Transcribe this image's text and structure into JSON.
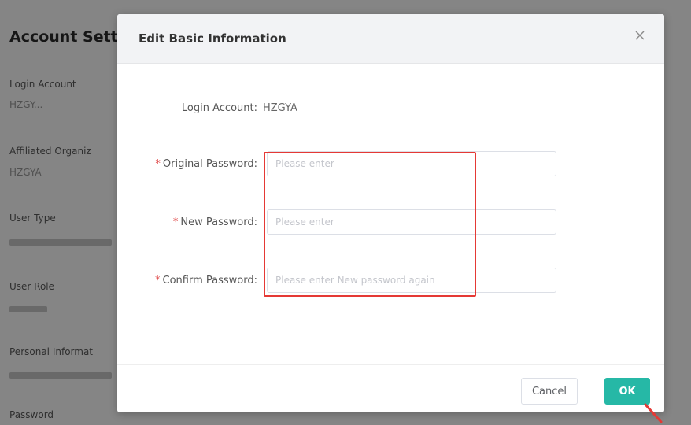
{
  "background": {
    "title": "Account Setti",
    "fields": [
      {
        "label": "Login Account",
        "value": "HZGY..."
      },
      {
        "label": "Affiliated Organiz",
        "value": "HZGYA"
      },
      {
        "label": "User Type",
        "value": ""
      },
      {
        "label": "User Role",
        "value": ""
      },
      {
        "label": "Personal Informat",
        "value": ""
      },
      {
        "label": "Password",
        "value": ""
      }
    ]
  },
  "dialog": {
    "title": "Edit Basic Information",
    "close_icon": "close-icon",
    "login_account": {
      "label": "Login Account:",
      "value": "HZGYA"
    },
    "original_password": {
      "required_mark": "*",
      "label": "Original Password:",
      "placeholder": "Please enter"
    },
    "new_password": {
      "required_mark": "*",
      "label": "New Password:",
      "placeholder": "Please enter"
    },
    "confirm_password": {
      "required_mark": "*",
      "label": "Confirm Password:",
      "placeholder": "Please enter New password again"
    },
    "cancel_label": "Cancel",
    "ok_label": "OK"
  },
  "colors": {
    "accent": "#26b8a6",
    "highlight": "#e53935",
    "required": "#e04b4b"
  }
}
